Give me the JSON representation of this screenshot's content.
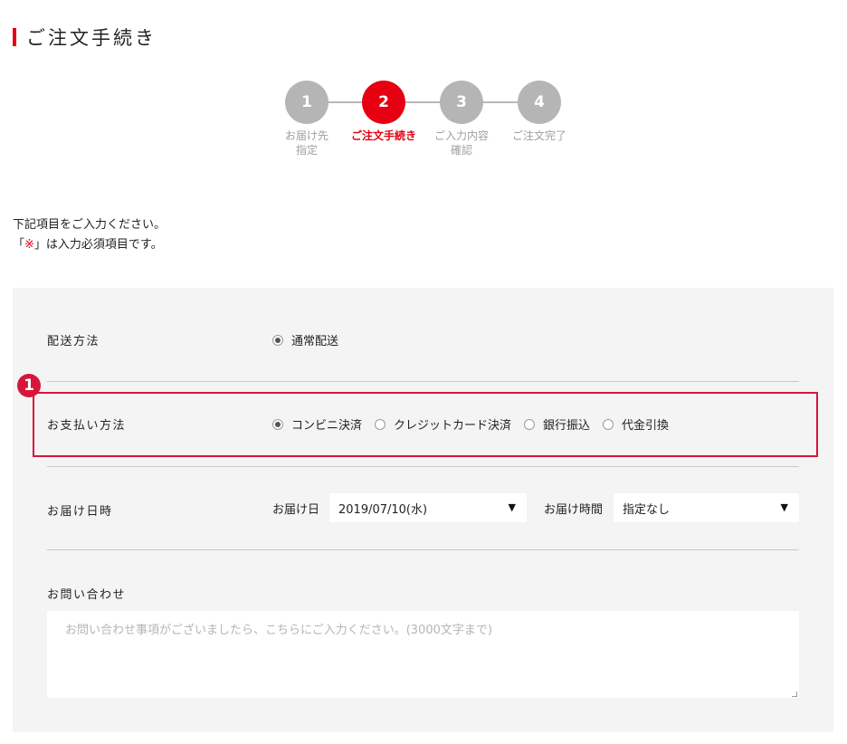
{
  "page": {
    "title": "ご注文手続き"
  },
  "steps": [
    {
      "number": "1",
      "label": "お届け先\n指定",
      "active": false
    },
    {
      "number": "2",
      "label": "ご注文手続き",
      "active": true
    },
    {
      "number": "3",
      "label": "ご入力内容\n確認",
      "active": false
    },
    {
      "number": "4",
      "label": "ご注文完了",
      "active": false
    }
  ],
  "instructions": {
    "line1": "下記項目をご入力ください。",
    "line2_prefix": "「",
    "required_mark": "※",
    "line2_suffix": "」は入力必須項目です。"
  },
  "form": {
    "shipping": {
      "label": "配送方法",
      "options": [
        {
          "label": "通常配送",
          "checked": true
        }
      ]
    },
    "payment": {
      "label": "お支払い方法",
      "badge": "1",
      "options": [
        {
          "label": "コンビニ決済",
          "checked": true
        },
        {
          "label": "クレジットカード決済",
          "checked": false
        },
        {
          "label": "銀行振込",
          "checked": false
        },
        {
          "label": "代金引換",
          "checked": false
        }
      ]
    },
    "delivery_datetime": {
      "label": "お届け日時",
      "date_label": "お届け日",
      "date_value": "2019/07/10(水)",
      "time_label": "お届け時間",
      "time_value": "指定なし"
    },
    "inquiry": {
      "label": "お問い合わせ",
      "placeholder": "お問い合わせ事項がございましたら、こちらにご入力ください。(3000文字まで)"
    }
  },
  "colors": {
    "accent": "#e60012",
    "highlight": "#d7153a",
    "panel": "#f4f4f4",
    "step_inactive": "#b5b5b5"
  },
  "icons": {
    "dropdown": "triangle-down-icon"
  }
}
